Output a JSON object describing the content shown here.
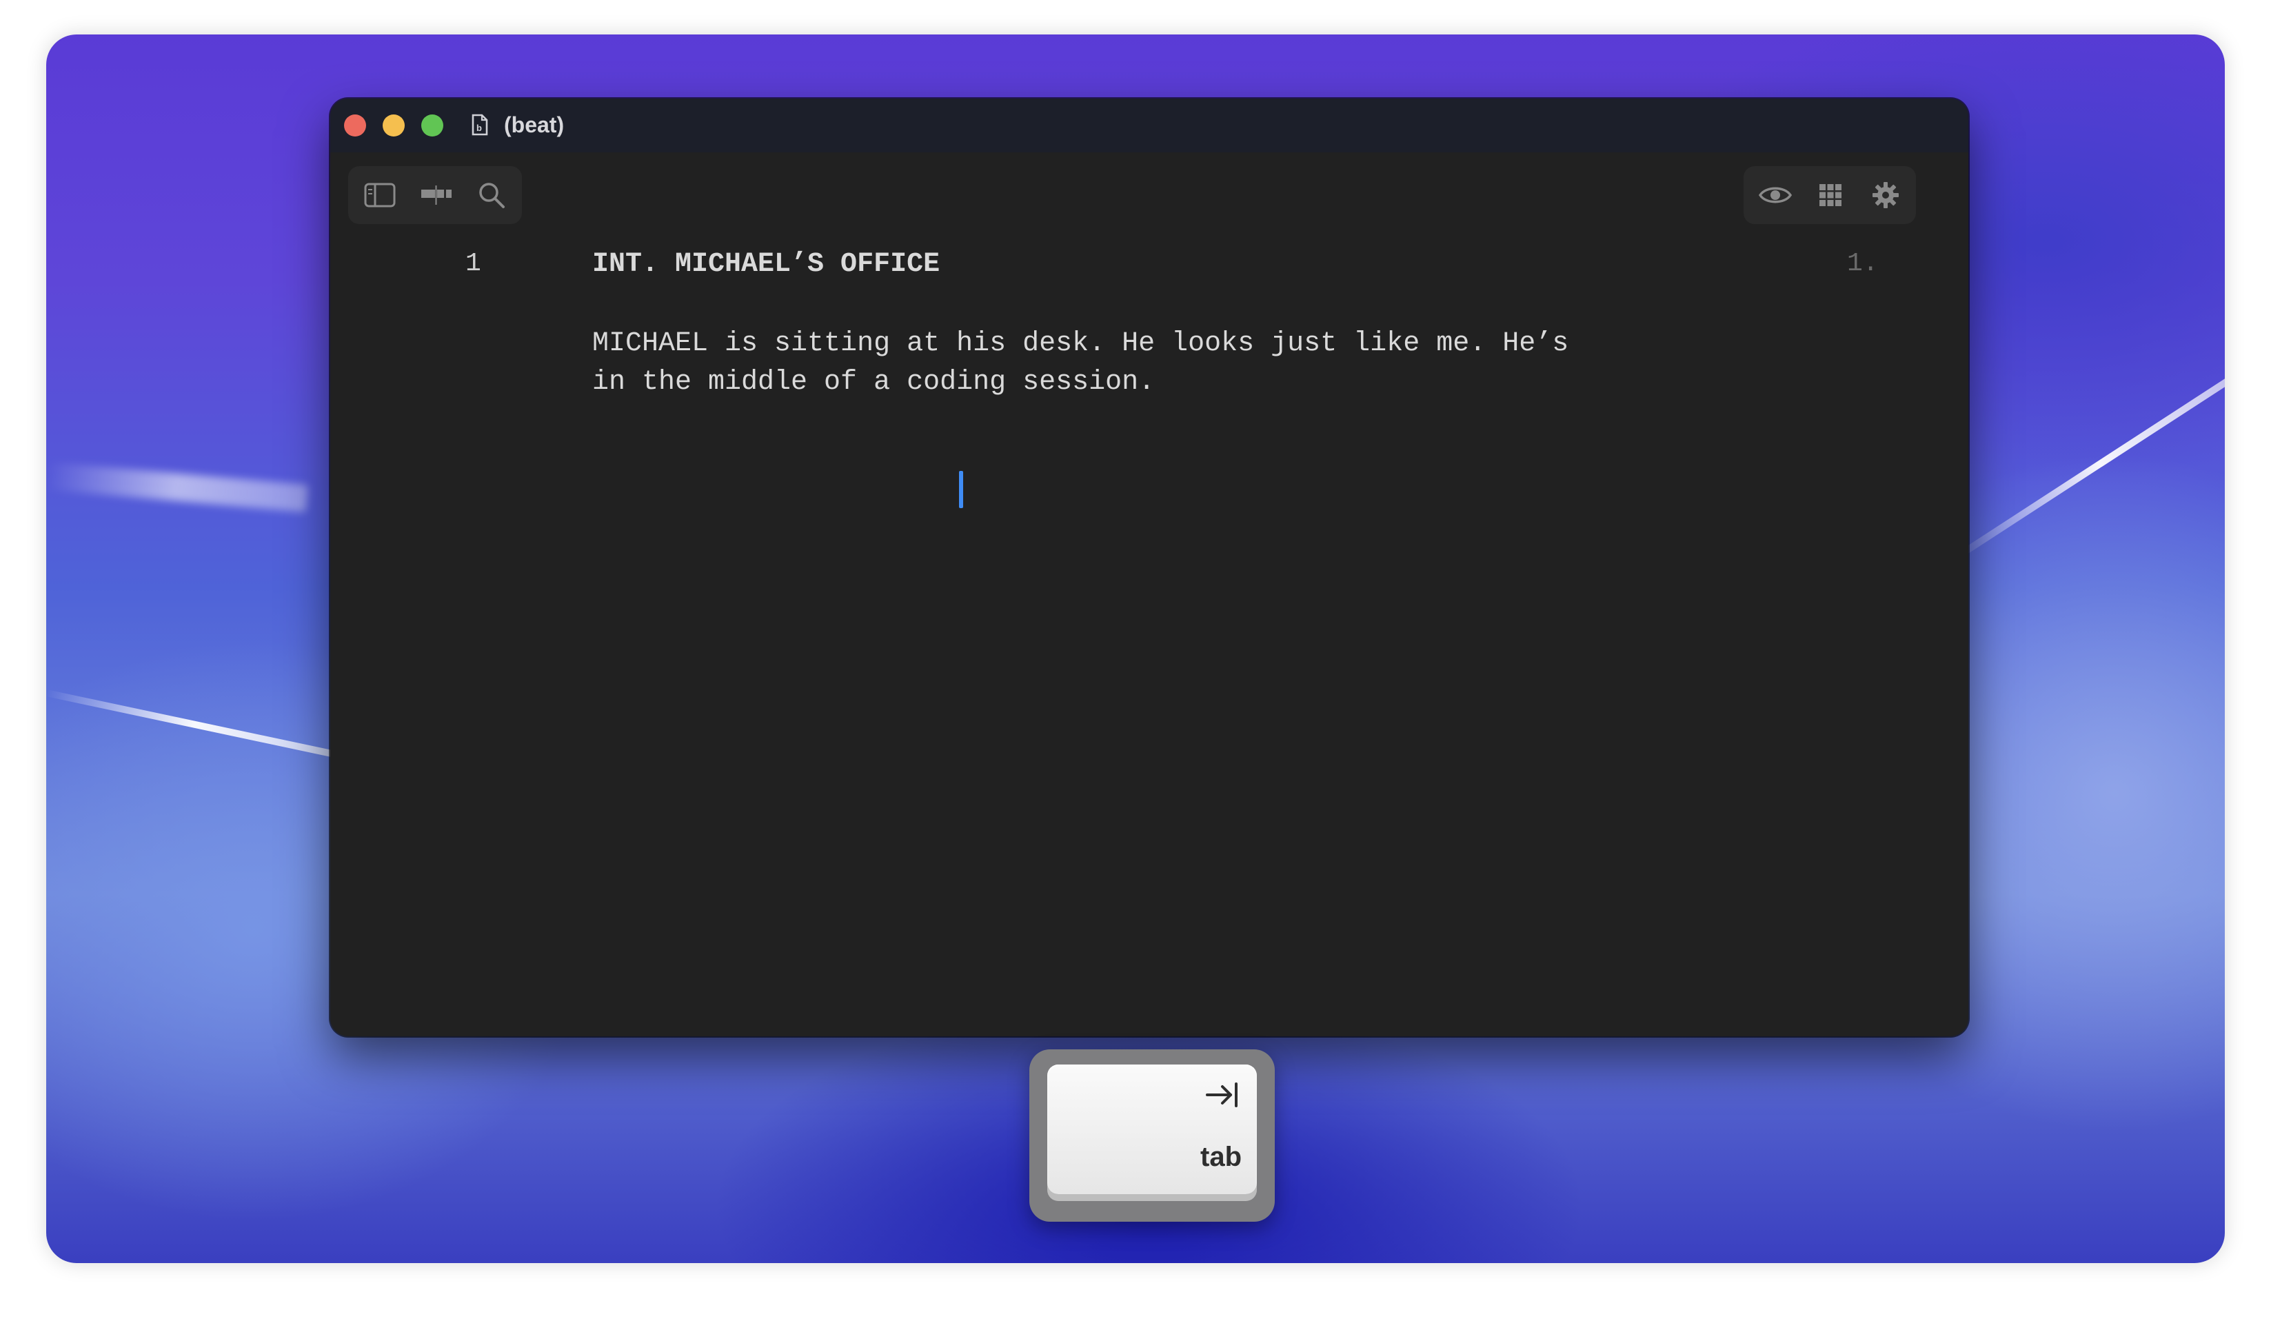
{
  "window": {
    "title": "(beat)"
  },
  "toolbar": {
    "left_icons": [
      "sidebar-icon",
      "timeline-icon",
      "search-icon"
    ],
    "right_icons": [
      "eye-icon",
      "grid-icon",
      "gear-icon"
    ]
  },
  "screenplay": {
    "scene_number": "1",
    "scene_heading": "INT. MICHAEL’S OFFICE",
    "page_number": "1.",
    "action_lines": [
      "MICHAEL is sitting at his desk. He looks just like me. He’s",
      "in the middle of a coding session."
    ]
  },
  "key_overlay": {
    "label": "tab",
    "icon": "tab-arrow-icon"
  },
  "colors": {
    "editor_background": "#212121",
    "titlebar": "#1c1f2a",
    "caret": "#3f8cf5",
    "close": "#ed6a5e",
    "minimize": "#f5bf4f",
    "maximize": "#61c554"
  }
}
